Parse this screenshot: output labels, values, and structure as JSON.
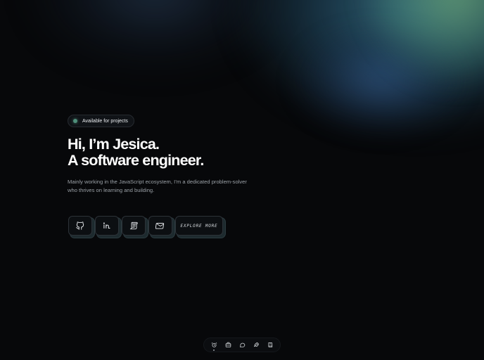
{
  "badge": {
    "label": "Available for projects",
    "dot_color": "#4f8f7a"
  },
  "hero": {
    "title_line1": "Hi, I’m Jesica.",
    "title_line2": "A software engineer.",
    "description": "Mainly working in the JavaScript ecosystem, I’m a dedicated problem-solver who thrives on learning and building."
  },
  "actions": {
    "icons": [
      "github-icon",
      "linkedin-icon",
      "resume-scroll-icon",
      "mail-icon"
    ],
    "explore_label": "EXPLORE MORE"
  },
  "dock": {
    "items": [
      "home-icon",
      "briefcase-icon",
      "chat-icon",
      "rocket-icon",
      "book-icon"
    ],
    "active_index": 0
  },
  "colors": {
    "background": "#07080a",
    "accent_green": "#4f8f7a",
    "glow_blue": "#3c788c"
  }
}
